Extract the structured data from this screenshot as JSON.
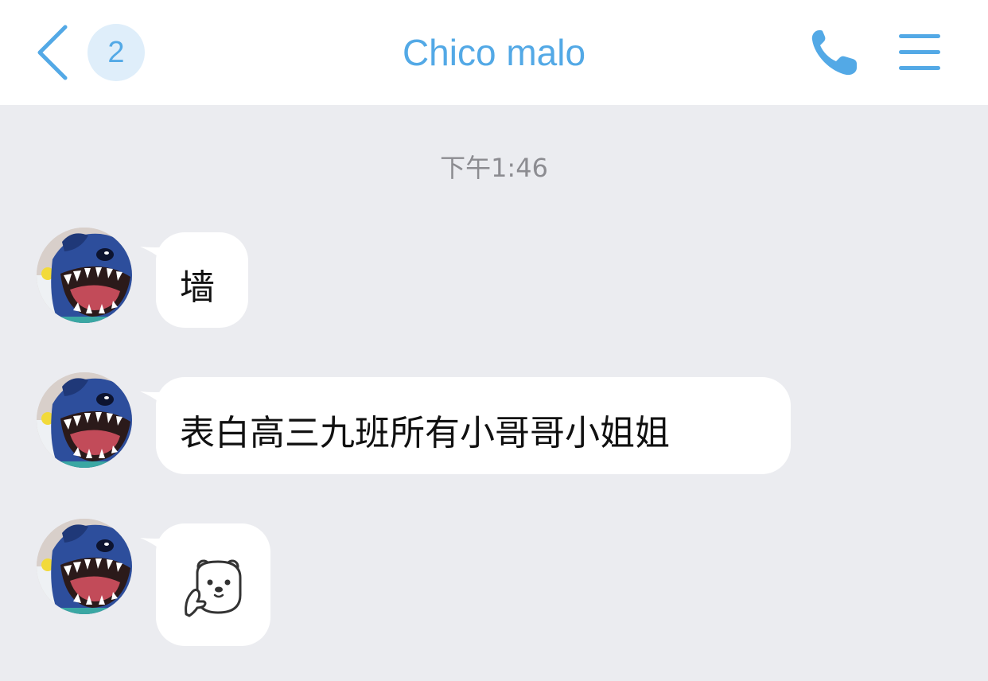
{
  "header": {
    "back_icon": "chevron-left-icon",
    "unread_count": "2",
    "title": "Chico malo",
    "call_icon": "phone-icon",
    "menu_icon": "hamburger-menu-icon",
    "accent_color": "#53a9e6"
  },
  "chat": {
    "timestamp": "下午1:46",
    "messages": [
      {
        "sender": "incoming",
        "type": "text",
        "text": "墙"
      },
      {
        "sender": "incoming",
        "type": "text",
        "text": "表白高三九班所有小哥哥小姐姐"
      },
      {
        "sender": "incoming",
        "type": "emoji",
        "emoji": "thinking-bear-emoji"
      }
    ]
  },
  "colors": {
    "background": "#ebecf0",
    "bubble": "#ffffff",
    "timestamp": "#8c8c91"
  }
}
